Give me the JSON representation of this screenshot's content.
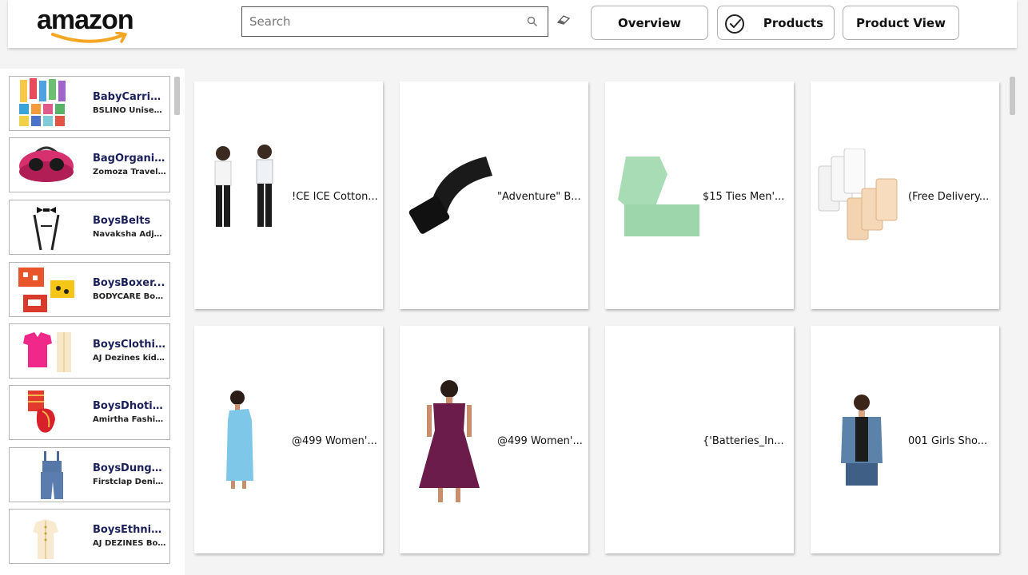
{
  "brand": {
    "logo_text": "amazon",
    "accent": "#f5a623"
  },
  "search": {
    "placeholder": "Search",
    "value": ""
  },
  "nav": {
    "overview": "Overview",
    "products": "Products",
    "product_view": "Product View"
  },
  "sidebar": {
    "items": [
      {
        "category": "BabyCarrie...",
        "name": "BSLINO Unisex ..."
      },
      {
        "category": "BagOrganiz...",
        "name": "Zomoza Travel ..."
      },
      {
        "category": "BoysBelts",
        "name": "Navaksha Adjus..."
      },
      {
        "category": "BoysBoxer...",
        "name": "BODYCARE Box..."
      },
      {
        "category": "BoysClothi...",
        "name": "AJ Dezines kids..."
      },
      {
        "category": "BoysDhotis...",
        "name": "Amirtha Fashio..."
      },
      {
        "category": "BoysDunga...",
        "name": "Firstclap Denim..."
      },
      {
        "category": "BoysEthnic...",
        "name": "AJ DEZINES Bo..."
      }
    ]
  },
  "grid": {
    "cards": [
      {
        "label": "!CE ICE Cotton..."
      },
      {
        "label": "\"Adventure\" B..."
      },
      {
        "label": "$15 Ties Men'..."
      },
      {
        "label": "(Free Delivery..."
      },
      {
        "label": "@499 Women'..."
      },
      {
        "label": "@499 Women'..."
      },
      {
        "label": "{'Batteries_In..."
      },
      {
        "label": "001 Girls Sho..."
      }
    ]
  }
}
